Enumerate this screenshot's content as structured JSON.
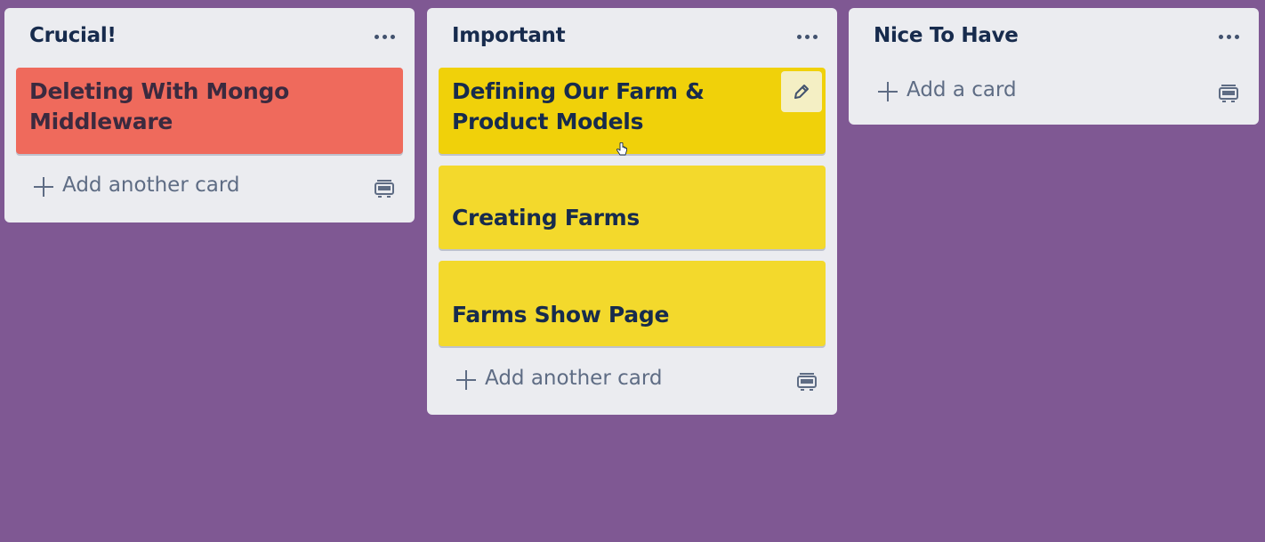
{
  "lists": [
    {
      "title": "Crucial!",
      "cards": [
        {
          "title": "Deleting With Mongo Middleware",
          "color": "#ef6a5c"
        }
      ],
      "add_label": "Add another card"
    },
    {
      "title": "Important",
      "cards": [
        {
          "title": "Defining Our Farm & Product Models",
          "color": "#f0d10a"
        },
        {
          "title": "Creating Farms",
          "color": "#f3d92c"
        },
        {
          "title": "Farms Show Page",
          "color": "#f3d92c"
        }
      ],
      "add_label": "Add another card"
    },
    {
      "title": "Nice To Have",
      "cards": [],
      "add_label": "Add a card"
    }
  ],
  "board_background": "#7f5893",
  "list_background": "#ebecf0",
  "icons": {
    "menu": "ellipsis-icon",
    "add": "plus-icon",
    "template": "card-template-icon",
    "edit": "pencil-icon"
  }
}
